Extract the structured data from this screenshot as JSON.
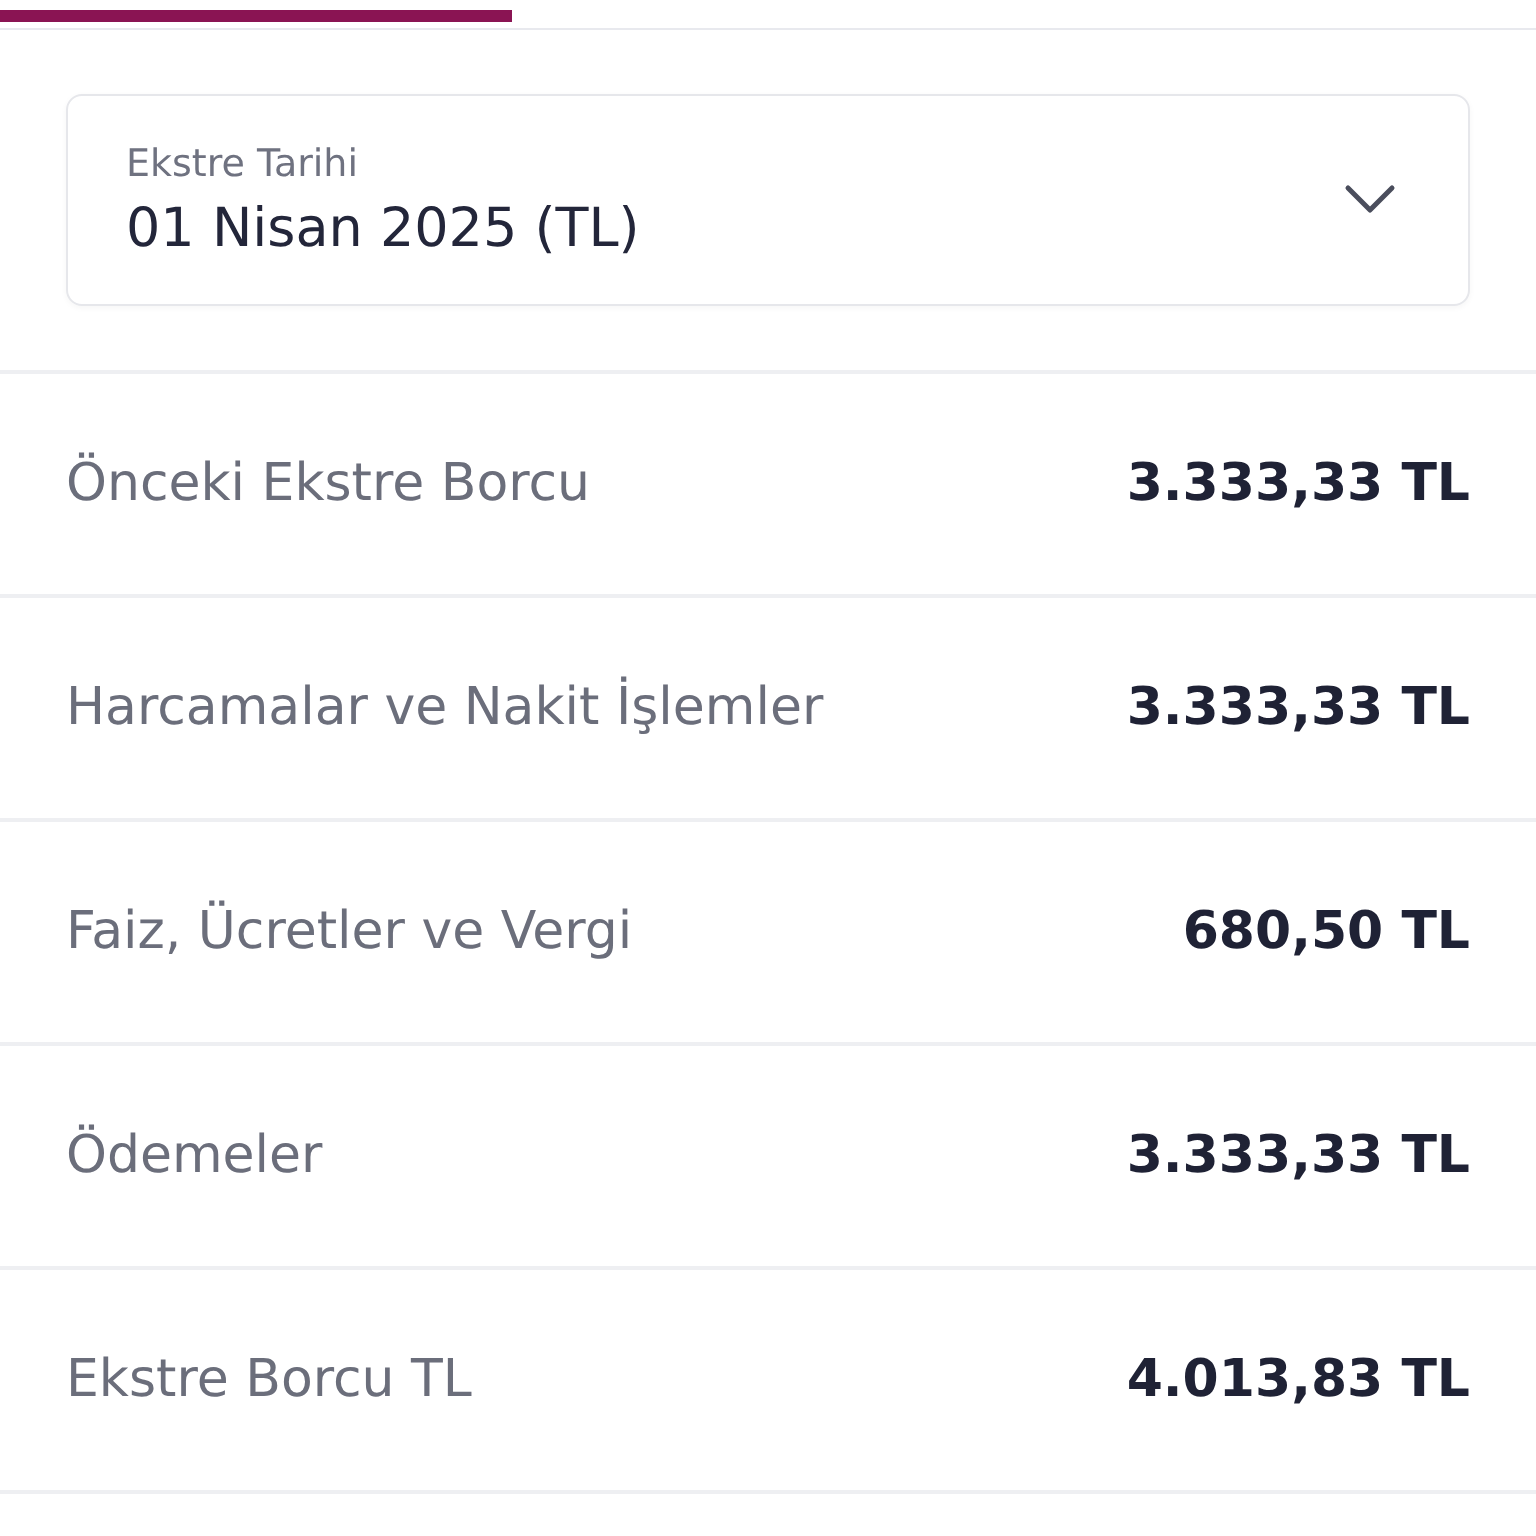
{
  "statement_date": {
    "label": "Ekstre Tarihi",
    "value": "01 Nisan 2025 (TL)"
  },
  "rows": [
    {
      "label": "Önceki Ekstre Borcu",
      "amount": "3.333,33 TL"
    },
    {
      "label": "Harcamalar ve Nakit İşlemler",
      "amount": "3.333,33 TL"
    },
    {
      "label": "Faiz, Ücretler ve Vergi",
      "amount": "680,50 TL"
    },
    {
      "label": "Ödemeler",
      "amount": "3.333,33 TL"
    },
    {
      "label": "Ekstre Borcu TL",
      "amount": "4.013,83 TL"
    }
  ]
}
